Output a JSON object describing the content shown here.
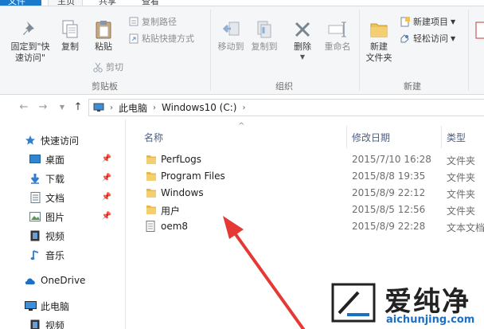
{
  "ribbon_tabs": {
    "file": "文件",
    "home": "主页",
    "share": "共享",
    "view": "查看"
  },
  "clipboard_group": {
    "label": "剪贴板",
    "pin_quick_access": "固定到\"快\n速访问\"",
    "copy": "复制",
    "paste": "粘贴",
    "copy_path": "复制路径",
    "paste_shortcut": "粘贴快捷方式",
    "cut": "剪切"
  },
  "organize_group": {
    "label": "组织",
    "move_to": "移动到",
    "copy_to": "复制到",
    "delete": "删除",
    "rename": "重命名"
  },
  "new_group": {
    "label": "新建",
    "new_folder": "新建\n文件夹",
    "new_item": "新建项目",
    "easy_access": "轻松访问"
  },
  "address": {
    "this_pc": "此电脑",
    "drive": "Windows10 (C:)"
  },
  "nav": {
    "quick_access": "快速访问",
    "desktop": "桌面",
    "downloads": "下载",
    "documents": "文档",
    "pictures": "图片",
    "videos": "视频",
    "music": "音乐",
    "onedrive": "OneDrive",
    "this_pc": "此电脑",
    "pc_videos": "视频"
  },
  "columns": {
    "name": "名称",
    "date": "修改日期",
    "type": "类型"
  },
  "files": [
    {
      "name": "PerfLogs",
      "date": "2015/7/10 16:28",
      "type": "文件夹",
      "icon": "folder-icon"
    },
    {
      "name": "Program Files",
      "date": "2015/8/8 19:35",
      "type": "文件夹",
      "icon": "folder-icon"
    },
    {
      "name": "Windows",
      "date": "2015/8/9 22:12",
      "type": "文件夹",
      "icon": "folder-icon"
    },
    {
      "name": "用户",
      "date": "2015/8/5 12:56",
      "type": "文件夹",
      "icon": "folder-icon"
    },
    {
      "name": "oem8",
      "date": "2015/8/9 22:28",
      "type": "文本文档",
      "icon": "text-file-icon"
    }
  ],
  "watermark": {
    "name": "爱纯净",
    "url": "aichunjing.com"
  },
  "colors": {
    "accent": "#1979ca",
    "folder": "#e8b94a",
    "arrow": "#e53935",
    "header_text": "#4d6082"
  }
}
